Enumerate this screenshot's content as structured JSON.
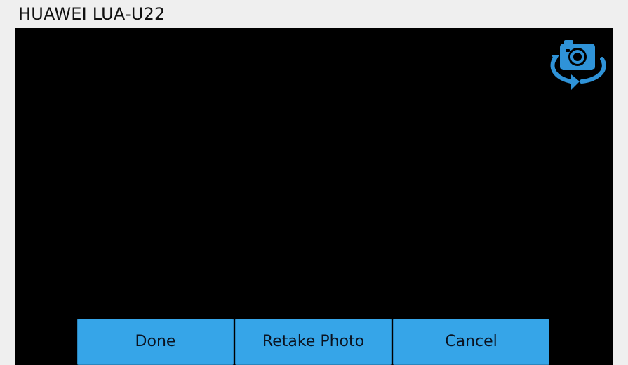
{
  "window": {
    "title": "HUAWEI LUA-U22"
  },
  "camera_view": {
    "switch_camera_icon": "switch-camera-icon",
    "accent_color": "#36a5e8",
    "background_color": "#000000"
  },
  "actions": {
    "done_label": "Done",
    "retake_label": "Retake Photo",
    "cancel_label": "Cancel"
  }
}
